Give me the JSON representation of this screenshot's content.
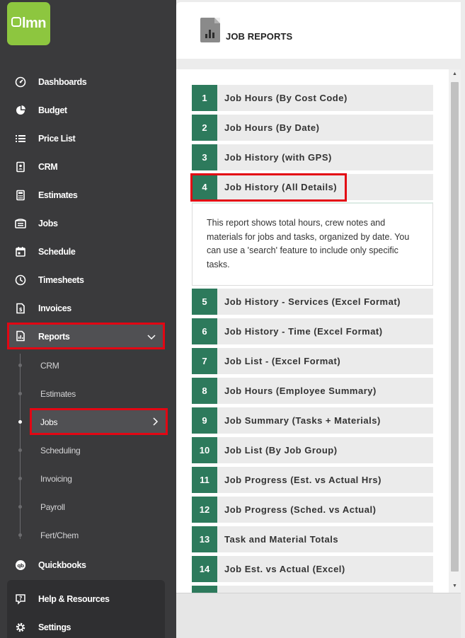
{
  "logo": {
    "text": "lmn"
  },
  "sidebar": {
    "items": [
      {
        "label": "Dashboards",
        "icon": "gauge-icon"
      },
      {
        "label": "Budget",
        "icon": "pie-chart-icon"
      },
      {
        "label": "Price List",
        "icon": "list-icon"
      },
      {
        "label": "CRM",
        "icon": "contact-book-icon"
      },
      {
        "label": "Estimates",
        "icon": "calculator-icon"
      },
      {
        "label": "Jobs",
        "icon": "jobs-icon"
      },
      {
        "label": "Schedule",
        "icon": "calendar-icon"
      },
      {
        "label": "Timesheets",
        "icon": "clock-icon"
      },
      {
        "label": "Invoices",
        "icon": "invoice-icon"
      }
    ],
    "reports": {
      "label": "Reports",
      "icon": "report-icon"
    },
    "report_sub": [
      "CRM",
      "Estimates",
      "Jobs",
      "Scheduling",
      "Invoicing",
      "Payroll",
      "Fert/Chem"
    ],
    "quickbooks": {
      "label": "Quickbooks",
      "icon": "quickbooks-icon"
    },
    "help": {
      "label": "Help & Resources",
      "icon": "help-icon"
    },
    "settings": {
      "label": "Settings",
      "icon": "settings-icon"
    }
  },
  "header": {
    "title": "JOB REPORTS",
    "icon": "report-document-icon"
  },
  "reports": [
    {
      "num": "1",
      "name": "Job Hours (By Cost Code)"
    },
    {
      "num": "2",
      "name": "Job Hours (By Date)"
    },
    {
      "num": "3",
      "name": "Job History (with GPS)"
    },
    {
      "num": "4",
      "name": "Job History (All Details)"
    },
    {
      "num": "5",
      "name": "Job History - Services (Excel Format)"
    },
    {
      "num": "6",
      "name": "Job History - Time (Excel Format)"
    },
    {
      "num": "7",
      "name": "Job List - (Excel Format)"
    },
    {
      "num": "8",
      "name": "Job Hours (Employee Summary)"
    },
    {
      "num": "9",
      "name": "Job Summary (Tasks + Materials)"
    },
    {
      "num": "10",
      "name": "Job List (By Job Group)"
    },
    {
      "num": "11",
      "name": "Job Progress (Est. vs Actual Hrs)"
    },
    {
      "num": "12",
      "name": "Job Progress (Sched. vs Actual)"
    },
    {
      "num": "13",
      "name": "Task and Material Totals"
    },
    {
      "num": "14",
      "name": "Job Est. vs Actual (Excel)"
    }
  ],
  "description": "This report shows total hours, crew notes and materials for jobs and tasks, organized by date. You can use a 'search' feature to include only specific tasks.",
  "colors": {
    "brand_green": "#8dc63f",
    "number_green": "#2d7a5c",
    "highlight_red": "#e30613",
    "sidebar": "#3a3a3c"
  }
}
